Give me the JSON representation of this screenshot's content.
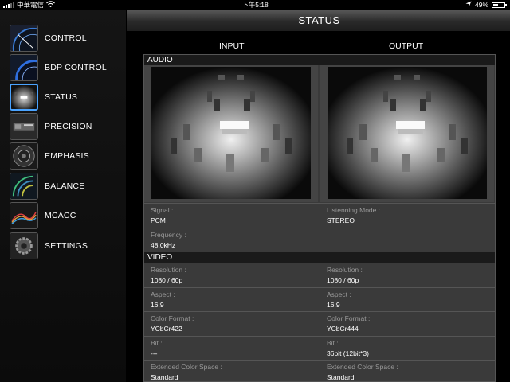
{
  "statusbar": {
    "carrier": "中華電信",
    "time": "下午5:18",
    "battery": "49%",
    "battery_level": 0.49
  },
  "sidebar": {
    "items": [
      {
        "label": "CONTROL",
        "icon": "control-icon"
      },
      {
        "label": "BDP CONTROL",
        "icon": "bdp-control-icon"
      },
      {
        "label": "STATUS",
        "icon": "status-icon",
        "active": true
      },
      {
        "label": "PRECISION",
        "icon": "precision-icon"
      },
      {
        "label": "EMPHASIS",
        "icon": "emphasis-icon"
      },
      {
        "label": "BALANCE",
        "icon": "balance-icon"
      },
      {
        "label": "MCACC",
        "icon": "mcacc-icon"
      },
      {
        "label": "SETTINGS",
        "icon": "settings-icon"
      }
    ]
  },
  "main": {
    "title": "STATUS",
    "input_label": "INPUT",
    "output_label": "OUTPUT",
    "audio": {
      "header": "AUDIO",
      "rows": [
        {
          "left": {
            "label": "Signal :",
            "value": "PCM"
          },
          "right": {
            "label": "Listenning Mode :",
            "value": "STEREO"
          }
        },
        {
          "left": {
            "label": "Frequency :",
            "value": "48.0kHz"
          },
          "right": {
            "label": "",
            "value": ""
          }
        }
      ]
    },
    "video": {
      "header": "VIDEO",
      "rows": [
        {
          "left": {
            "label": "Resolution :",
            "value": "1080 / 60p"
          },
          "right": {
            "label": "Resolution :",
            "value": "1080 / 60p"
          }
        },
        {
          "left": {
            "label": "Aspect :",
            "value": "16:9"
          },
          "right": {
            "label": "Aspect :",
            "value": "16:9"
          }
        },
        {
          "left": {
            "label": "Color Format :",
            "value": "YCbCr422"
          },
          "right": {
            "label": "Color Format :",
            "value": "YCbCr444"
          }
        },
        {
          "left": {
            "label": "Bit :",
            "value": "---"
          },
          "right": {
            "label": "Bit :",
            "value": "36bit (12bit*3)"
          }
        },
        {
          "left": {
            "label": "Extended Color Space :",
            "value": "Standard"
          },
          "right": {
            "label": "Extended Color Space :",
            "value": "Standard"
          }
        }
      ]
    }
  },
  "colors": {
    "accent": "#4aa3ff",
    "panel": "#3a3a3a",
    "header": "#1a1a1a"
  }
}
